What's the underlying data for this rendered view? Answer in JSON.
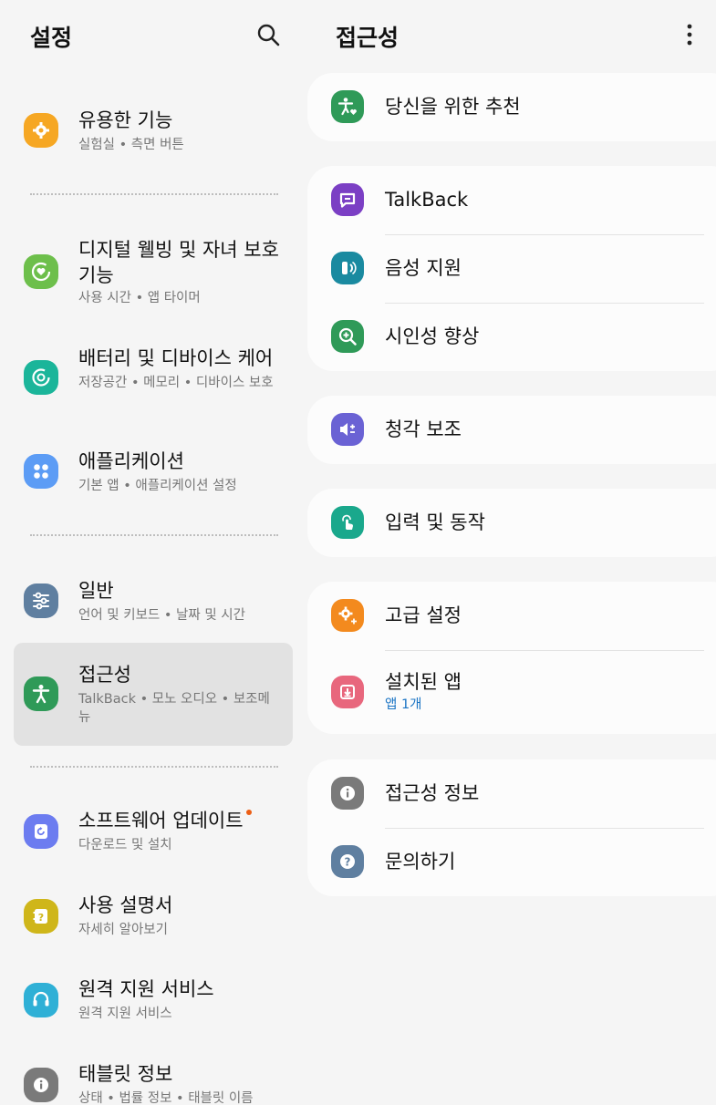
{
  "left": {
    "title": "설정",
    "items": [
      {
        "title": "유용한 기능",
        "subtitle": "실험실 • 측면 버튼",
        "icon": "puzzle-gear-icon",
        "color": "#f6a723"
      },
      {
        "title": "디지털 웰빙 및 자녀 보호 기능",
        "subtitle": "사용 시간 • 앱 타이머",
        "icon": "heart-circle-icon",
        "color": "#6dbf4b"
      },
      {
        "title": "배터리 및 디바이스 케어",
        "subtitle": "저장공간 • 메모리 • 디바이스 보호",
        "icon": "device-care-icon",
        "color": "#1bb59a"
      },
      {
        "title": "애플리케이션",
        "subtitle": "기본 앱 • 애플리케이션 설정",
        "icon": "apps-grid-icon",
        "color": "#5c9cf5"
      },
      {
        "title": "일반",
        "subtitle": "언어 및 키보드 • 날짜 및 시간",
        "icon": "sliders-icon",
        "color": "#5f7fa0"
      },
      {
        "title": "접근성",
        "subtitle": "TalkBack • 모노 오디오 • 보조메뉴",
        "icon": "accessibility-icon",
        "color": "#2f9a58"
      },
      {
        "title": "소프트웨어 업데이트",
        "subtitle": "다운로드 및 설치",
        "icon": "update-icon",
        "color": "#6c7cf0"
      },
      {
        "title": "사용 설명서",
        "subtitle": "자세히 알아보기",
        "icon": "manual-icon",
        "color": "#cfb61a"
      },
      {
        "title": "원격 지원 서비스",
        "subtitle": "원격 지원 서비스",
        "icon": "headset-icon",
        "color": "#2fb0d6"
      },
      {
        "title": "태블릿 정보",
        "subtitle": "상태 • 법률 정보 • 태블릿 이름",
        "icon": "info-icon",
        "color": "#7a7a7a"
      }
    ]
  },
  "right": {
    "title": "접근성",
    "items": [
      {
        "title": "당신을 위한 추천",
        "icon": "accessibility-heart-icon",
        "color": "#2f9a58"
      },
      {
        "title": "TalkBack",
        "icon": "talkback-icon",
        "color": "#7b3fc4"
      },
      {
        "title": "음성 지원",
        "icon": "voice-assistant-icon",
        "color": "#1a8aa0"
      },
      {
        "title": "시인성 향상",
        "icon": "magnify-plus-icon",
        "color": "#2f9a58"
      },
      {
        "title": "청각 보조",
        "icon": "hearing-icon",
        "color": "#6a62d4"
      },
      {
        "title": "입력 및 동작",
        "icon": "touch-icon",
        "color": "#1aa88c"
      },
      {
        "title": "고급 설정",
        "icon": "advanced-gear-icon",
        "color": "#f38a1e"
      },
      {
        "title": "설치된 앱",
        "subtitle": "앱 1개",
        "icon": "installed-apps-icon",
        "color": "#e8677d"
      },
      {
        "title": "접근성 정보",
        "icon": "info-icon",
        "color": "#7a7a7a"
      },
      {
        "title": "문의하기",
        "icon": "help-icon",
        "color": "#5f7fa0"
      }
    ]
  }
}
